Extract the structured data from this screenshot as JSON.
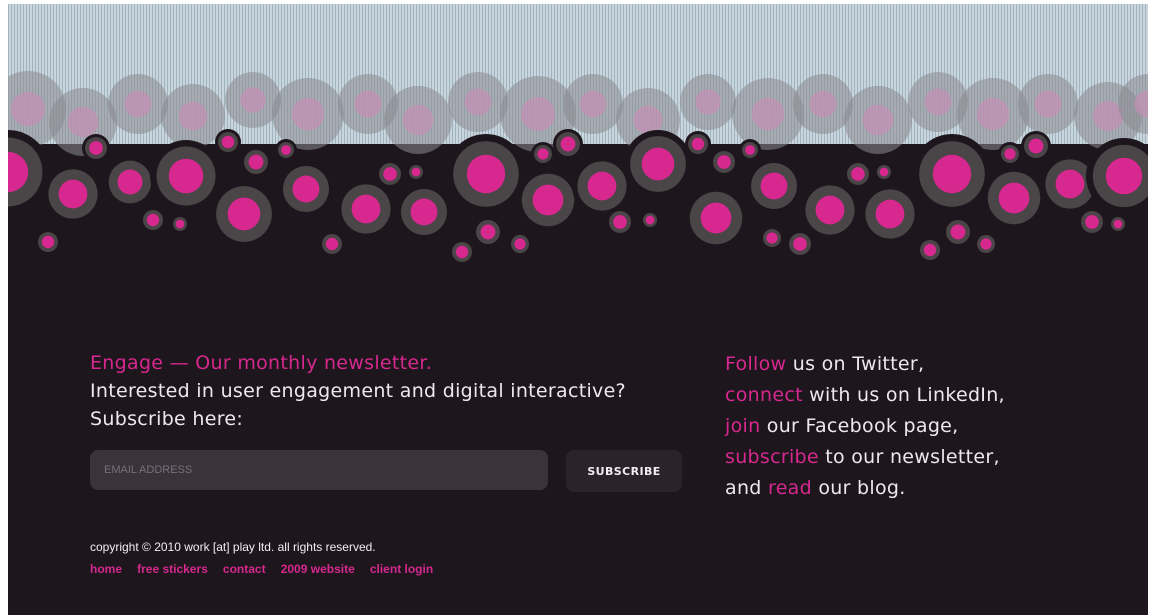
{
  "colors": {
    "accent": "#d6288e",
    "background": "#1e161d",
    "text": "#eee8ed",
    "field": "#3a3339",
    "bubble_grey": "#4a4547"
  },
  "header": {
    "decoration": "pink-and-grey-bubbles-illustration"
  },
  "newsletter": {
    "title": "Engage — Our monthly newsletter.",
    "line1": "Interested in user engagement and digital interactive?",
    "line2": "Subscribe here:",
    "email_placeholder": "EMAIL ADDRESS",
    "email_value": "",
    "subscribe_label": "SUBSCRIBE"
  },
  "social": [
    {
      "link": "Follow",
      "text": " us on Twitter,"
    },
    {
      "link": "connect",
      "text": " with us on LinkedIn,"
    },
    {
      "link": "join",
      "text": " our Facebook page,"
    },
    {
      "link": "subscribe",
      "text": " to our newsletter,"
    },
    {
      "prefix": "and ",
      "link": "read",
      "text": " our blog."
    }
  ],
  "footer": {
    "copyright": "copyright © 2010 work [at] play ltd. all rights reserved.",
    "links": [
      "home",
      "free stickers",
      "contact",
      "2009 website",
      "client login"
    ]
  }
}
